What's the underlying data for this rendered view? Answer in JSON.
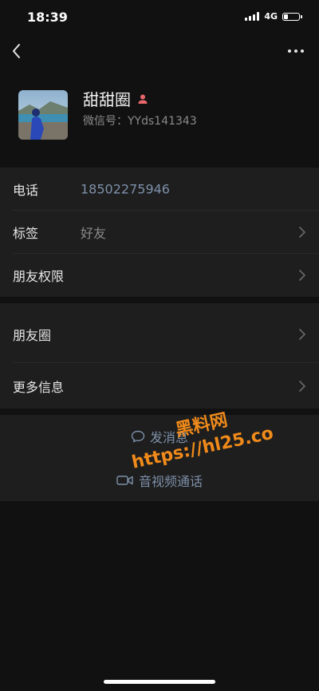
{
  "status_bar": {
    "time": "18:39",
    "network": "4G",
    "battery_level": 0.3
  },
  "nav": {
    "back_icon": "chevron-left-icon",
    "more_icon": "more-dots-icon"
  },
  "profile": {
    "name": "甜甜圈",
    "gender_icon": "female-icon",
    "wechat_id": "微信号：YYds141343"
  },
  "info_rows": [
    {
      "label": "电话",
      "value": "18502275946",
      "has_chevron": false
    },
    {
      "label": "标签",
      "value": "好友",
      "has_chevron": true
    },
    {
      "label": "朋友权限",
      "value": "",
      "has_chevron": true
    }
  ],
  "section2_rows": [
    {
      "label": "朋友圈",
      "has_chevron": true
    },
    {
      "label": "更多信息",
      "has_chevron": true
    }
  ],
  "actions": {
    "message": {
      "label": "发消息",
      "icon": "chat-bubble-icon"
    },
    "call": {
      "label": "音视频通话",
      "icon": "video-icon"
    }
  },
  "watermark": {
    "line1": "黑料网",
    "line2": "https://hl25.co"
  },
  "colors": {
    "accent_link": "#7d90a9",
    "value_gray": "#8a8a8a",
    "watermark": "#f08a1a"
  }
}
